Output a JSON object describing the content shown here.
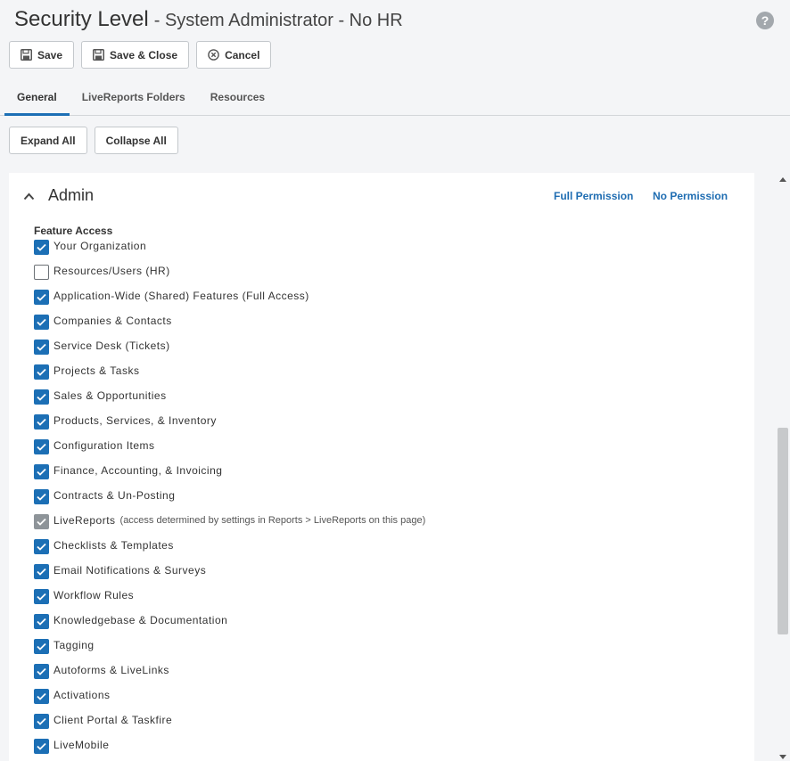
{
  "header": {
    "title": "Security Level",
    "subtitle": "- System Administrator - No HR",
    "help": "?"
  },
  "toolbar": {
    "save": "Save",
    "save_close": "Save & Close",
    "cancel": "Cancel"
  },
  "tabs": [
    {
      "label": "General",
      "active": true
    },
    {
      "label": "LiveReports Folders",
      "active": false
    },
    {
      "label": "Resources",
      "active": false
    }
  ],
  "expand_all": "Expand All",
  "collapse_all": "Collapse All",
  "section": {
    "title": "Admin",
    "full_permission": "Full Permission",
    "no_permission": "No Permission",
    "feature_access_label": "Feature Access",
    "items": [
      {
        "label": "Your Organization",
        "state": "checked"
      },
      {
        "label": "Resources/Users (HR)",
        "state": "unchecked"
      },
      {
        "label": "Application-Wide (Shared) Features (Full Access)",
        "state": "checked"
      },
      {
        "label": "Companies & Contacts",
        "state": "checked"
      },
      {
        "label": "Service Desk (Tickets)",
        "state": "checked"
      },
      {
        "label": "Projects & Tasks",
        "state": "checked"
      },
      {
        "label": "Sales & Opportunities",
        "state": "checked"
      },
      {
        "label": "Products, Services, & Inventory",
        "state": "checked"
      },
      {
        "label": "Configuration Items",
        "state": "checked"
      },
      {
        "label": "Finance, Accounting, & Invoicing",
        "state": "checked"
      },
      {
        "label": "Contracts & Un-Posting",
        "state": "checked"
      },
      {
        "label": "LiveReports",
        "state": "disabled",
        "note": "(access determined by settings in Reports > LiveReports on this page)"
      },
      {
        "label": "Checklists & Templates",
        "state": "checked"
      },
      {
        "label": "Email Notifications & Surveys",
        "state": "checked"
      },
      {
        "label": "Workflow Rules",
        "state": "checked"
      },
      {
        "label": "Knowledgebase & Documentation",
        "state": "checked"
      },
      {
        "label": "Tagging",
        "state": "checked"
      },
      {
        "label": "Autoforms & LiveLinks",
        "state": "checked"
      },
      {
        "label": "Activations",
        "state": "checked"
      },
      {
        "label": "Client Portal & Taskfire",
        "state": "checked"
      },
      {
        "label": "LiveMobile",
        "state": "checked"
      }
    ]
  },
  "colors": {
    "accent": "#1c6fb5",
    "link": "#1f6db2",
    "disabled_check": "#8e9499"
  },
  "icons": {
    "save": "floppy-disk-icon",
    "cancel": "circle-x-icon",
    "help": "question-circle-icon",
    "collapse": "chevron-up-icon",
    "checkbox": "checkmark-icon"
  }
}
